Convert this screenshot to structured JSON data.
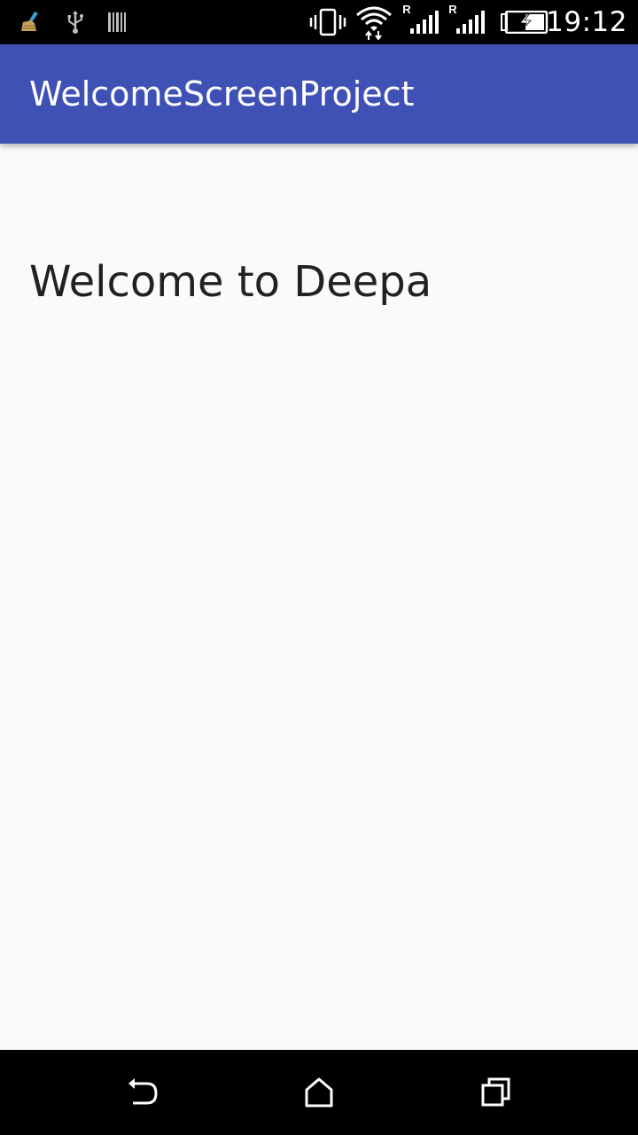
{
  "status_bar": {
    "time": "19:12",
    "roaming_indicator_1": "R",
    "roaming_indicator_2": "R",
    "icons": [
      "cleaner-icon",
      "usb-icon",
      "barcode-icon",
      "vibrate-icon",
      "wifi-icon",
      "signal-icon",
      "signal-icon",
      "battery-charging-icon"
    ]
  },
  "app_bar": {
    "title": "WelcomeScreenProject",
    "color": "#3f51b5"
  },
  "main": {
    "welcome_text": "Welcome to Deepa"
  },
  "nav_bar": {
    "buttons": [
      "back-icon",
      "home-icon",
      "recents-icon"
    ]
  }
}
